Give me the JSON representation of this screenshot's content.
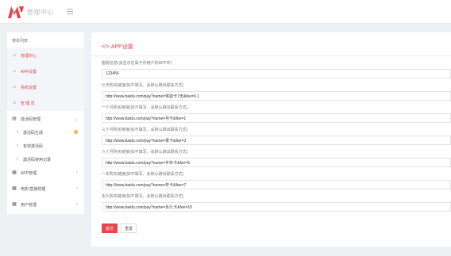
{
  "header": {
    "brand": "管理中心",
    "logo_color": "#e5454b"
  },
  "sidebar": {
    "title": "菜单列表",
    "items": [
      {
        "label": "管理中心",
        "icon": "home-icon"
      },
      {
        "label": "APP设置",
        "icon": "home-icon"
      },
      {
        "label": "系统设置",
        "icon": "home-icon"
      },
      {
        "label": "管 理 员",
        "icon": "home-icon"
      },
      {
        "label": "激活码管理",
        "icon": "calendar-icon"
      },
      {
        "label": "激活码生成",
        "icon": "chevron-right-icon"
      },
      {
        "label": "有效激活码",
        "icon": "chevron-right-icon"
      },
      {
        "label": "激活码使用记录",
        "icon": "chevron-right-icon"
      },
      {
        "label": "APP管理",
        "icon": "grid-icon"
      },
      {
        "label": "电影/直播管理",
        "icon": "grid-icon"
      },
      {
        "label": "用户管理",
        "icon": "grid-icon"
      }
    ]
  },
  "panel": {
    "title": "APP设置",
    "title_icon": "code-icon",
    "fields": [
      {
        "label": "客服信息(会显示在属于你用户的APP中)",
        "value": "123456"
      },
      {
        "label": "七天购买链接(如不填写，会默认跳出联系方式)",
        "value": "http://www.baidu.com/pay?name=体验卡7天&fee=0.1"
      },
      {
        "label": "一个月购买链接(如不填写，会默认跳出联系方式)",
        "value": "http://www.baidu.com/pay?name=月卡&fee=1"
      },
      {
        "label": "三个月购买链接(如不填写，会默认跳出联系方式)",
        "value": "http://www.baidu.com/pay?name=季卡&fee=3"
      },
      {
        "label": "六个月购买链接(如不填写，会默认跳出联系方式)",
        "value": "http://www.baidu.com/pay?name=半年卡&fee=5"
      },
      {
        "label": "一年购买链接(如不填写，会默认跳出联系方式)",
        "value": "http://www.baidu.com/pay?name=年卡&fee=7"
      },
      {
        "label": "永久购买链接(如不填写，会默认跳出联系方式)",
        "value": "http://www.baidu.com/pay?name=永久卡&fee=10"
      }
    ],
    "submit_label": "提交",
    "reset_label": "重置"
  },
  "accent_color": "#e5454b"
}
